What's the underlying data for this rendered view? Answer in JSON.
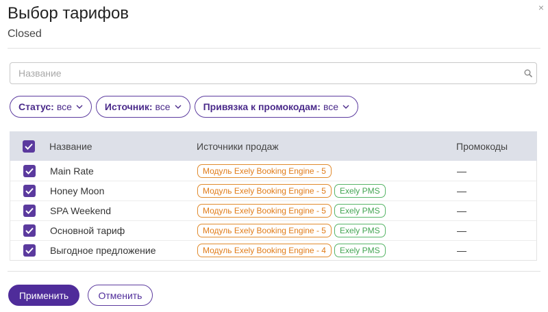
{
  "dialog": {
    "title": "Выбор тарифов",
    "subtitle": "Closed",
    "close_glyph": "×"
  },
  "search": {
    "placeholder": "Название",
    "value": ""
  },
  "filters": [
    {
      "label": "Статус:",
      "value": "все"
    },
    {
      "label": "Источник:",
      "value": "все"
    },
    {
      "label": "Привязка к промокодам:",
      "value": "все"
    }
  ],
  "table": {
    "headers": {
      "name": "Название",
      "sources": "Источники продаж",
      "promos": "Промокоды"
    },
    "rows": [
      {
        "name": "Main Rate",
        "checked": true,
        "sources": [
          "Модуль Exely Booking Engine - 5"
        ],
        "promo": "—"
      },
      {
        "name": "Honey Moon",
        "checked": true,
        "sources": [
          "Модуль Exely Booking Engine - 5",
          "Exely PMS"
        ],
        "promo": "—"
      },
      {
        "name": "SPA Weekend",
        "checked": true,
        "sources": [
          "Модуль Exely Booking Engine - 5",
          "Exely PMS"
        ],
        "promo": "—"
      },
      {
        "name": "Основной тариф",
        "checked": true,
        "sources": [
          "Модуль Exely Booking Engine - 5",
          "Exely PMS"
        ],
        "promo": "—"
      },
      {
        "name": "Выгодное предложение",
        "checked": true,
        "sources": [
          "Модуль Exely Booking Engine - 4",
          "Exely PMS"
        ],
        "promo": "—"
      }
    ]
  },
  "actions": {
    "apply_label": "Применить",
    "cancel_label": "Отменить"
  },
  "colors": {
    "accent": "#5b3a9e",
    "primary_button": "#4f2c9a",
    "tag_orange": "#e07b18",
    "tag_green": "#43a553",
    "header_bg": "#dde0e8"
  },
  "icons": {
    "close": "close-icon",
    "search": "search-icon",
    "check": "checkmark-icon",
    "dropdown": "chevron-down-icon"
  }
}
